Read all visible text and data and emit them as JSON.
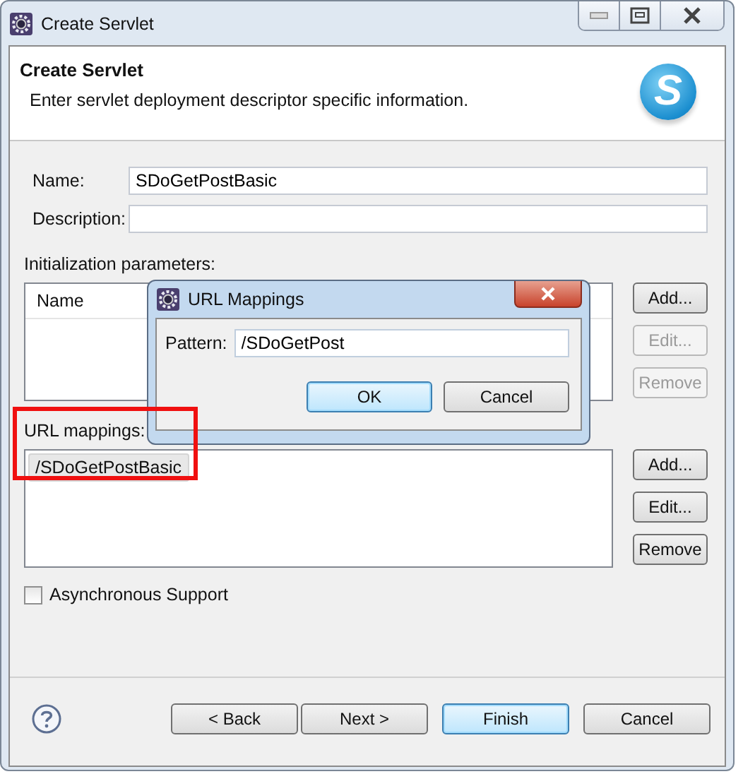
{
  "window": {
    "title": "Create Servlet"
  },
  "header": {
    "title": "Create Servlet",
    "subtitle": "Enter servlet deployment descriptor specific information.",
    "logo_text": "S"
  },
  "fields": [
    {
      "label": "Name:",
      "value": "SDoGetPostBasic"
    },
    {
      "label": "Description:"
    }
  ],
  "init_parameters": {
    "label": "Initialization parameters:",
    "columns": [
      "Name"
    ],
    "buttons": [
      {
        "label": "Add...",
        "disabled": false
      },
      {
        "label": "Edit...",
        "disabled": true
      },
      {
        "label": "Remove",
        "disabled": true
      }
    ]
  },
  "url_mappings": {
    "label": "URL mappings:",
    "highlighted": true,
    "items": [
      {
        "text": "/SDoGetPostBasic",
        "selected": true
      }
    ],
    "buttons": [
      {
        "label": "Add...",
        "disabled": false
      },
      {
        "label": "Edit...",
        "disabled": false
      },
      {
        "label": "Remove",
        "disabled": false
      }
    ]
  },
  "async": {
    "label": "Asynchronous Support",
    "checked": false
  },
  "footer": {
    "buttons": [
      {
        "label": "< Back",
        "default": false
      },
      {
        "label": "Next >",
        "default": false
      },
      {
        "label": "Finish",
        "default": true
      },
      {
        "label": "Cancel",
        "default": false
      }
    ]
  },
  "dialog": {
    "title": "URL Mappings",
    "pattern_label": "Pattern:",
    "pattern_value": "/SDoGetPost",
    "buttons": [
      {
        "label": "OK",
        "default": true
      },
      {
        "label": "Cancel",
        "default": false
      }
    ]
  }
}
